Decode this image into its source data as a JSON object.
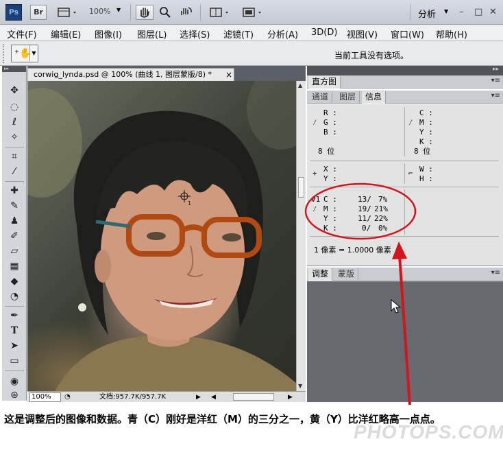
{
  "appbar": {
    "logo": "Ps",
    "bridge": "Br",
    "zoom": "100%",
    "workspace": "分析",
    "window_controls": [
      "–",
      "□",
      "✕"
    ],
    "icons": [
      "layout-icon",
      "hand-icon",
      "zoom-icon",
      "rotate-icon",
      "arrange-icon",
      "screen-mode-icon"
    ]
  },
  "menu": [
    "文件(F)",
    "编辑(E)",
    "图像(I)",
    "图层(L)",
    "选择(S)",
    "滤镜(T)",
    "分析(A)",
    "3D(D)",
    "视图(V)",
    "窗口(W)",
    "帮助(H)"
  ],
  "options": {
    "message": "当前工具没有选项。"
  },
  "document": {
    "tab_title": "corwig_lynda.psd @ 100% (曲线 1, 图层蒙版/8) *",
    "close": "×",
    "zoom": "100%",
    "doc_size": "文档:957.7K/957.7K",
    "marker_label": "1"
  },
  "panels": {
    "histogram_tab": "直方图",
    "info_tabs": [
      "通道",
      "图层",
      "信息"
    ],
    "adjust_tabs": [
      "调整",
      "蒙版"
    ],
    "info": {
      "rgb_labels": [
        "R :",
        "G :",
        "B :"
      ],
      "cmyk_labels": [
        "C :",
        "M :",
        "Y :",
        "K :"
      ],
      "bits_left": "8 位",
      "bits_right": "8 位",
      "xy_labels": [
        "X :",
        "Y :"
      ],
      "wh_labels": [
        "W :",
        "H :"
      ],
      "sampler_id": "#1",
      "sampler": [
        {
          "ch": "C :",
          "value": "13/",
          "pct": "7%"
        },
        {
          "ch": "M :",
          "value": "19/",
          "pct": "21%"
        },
        {
          "ch": "Y :",
          "value": "11/",
          "pct": "22%"
        },
        {
          "ch": "K :",
          "value": "0/",
          "pct": "0%"
        }
      ],
      "pixel_ratio": "1 像素 = 1.0000 像素"
    }
  },
  "annotation": {
    "caption": "这是调整后的图像和数据。青（C）刚好是洋红（M）的三分之一，黄（Y）比洋红略高一点点。",
    "watermark": "PHOTOPS.COM",
    "highlight_color": "#d3141c"
  }
}
